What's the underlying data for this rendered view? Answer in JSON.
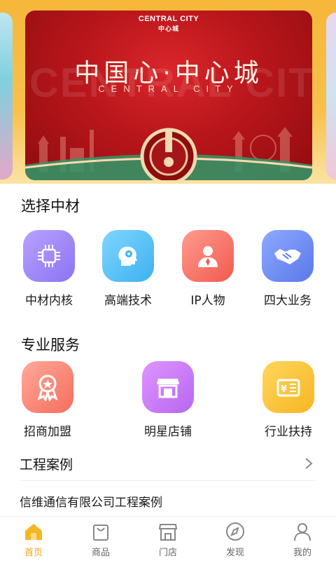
{
  "banner": {
    "brand_en": "CENTRAL CITY",
    "brand_cn": "中心城",
    "title": "中国心·中心城",
    "subtitle": "CENTRAL CITY",
    "ghost_text": "CENTRAL CITY"
  },
  "section_choose": {
    "title": "选择中材",
    "items": [
      {
        "label": "中材内核",
        "icon": "chip-icon",
        "color": "#8b73f3"
      },
      {
        "label": "高端技术",
        "icon": "head-gear-icon",
        "color": "#3db1f0"
      },
      {
        "label": "IP人物",
        "icon": "person-icon",
        "color": "#f25a4f"
      },
      {
        "label": "四大业务",
        "icon": "handshake-icon",
        "color": "#5a78ea"
      }
    ]
  },
  "section_service": {
    "title": "专业服务",
    "items": [
      {
        "label": "招商加盟",
        "icon": "award-ribbon-icon",
        "color": "#f66d5d"
      },
      {
        "label": "明星店铺",
        "icon": "storefront-icon",
        "color": "#b766ef"
      },
      {
        "label": "行业扶持",
        "icon": "money-icon",
        "color": "#f6b624"
      }
    ]
  },
  "cases": {
    "title": "工程案例",
    "item": "信维通信有限公司工程案例"
  },
  "tabbar": {
    "active_color": "#f2a514",
    "items": [
      {
        "label": "首页",
        "icon": "home-icon"
      },
      {
        "label": "商品",
        "icon": "shopping-bag-icon"
      },
      {
        "label": "门店",
        "icon": "store-icon"
      },
      {
        "label": "发现",
        "icon": "compass-icon"
      },
      {
        "label": "我的",
        "icon": "user-icon"
      }
    ]
  }
}
